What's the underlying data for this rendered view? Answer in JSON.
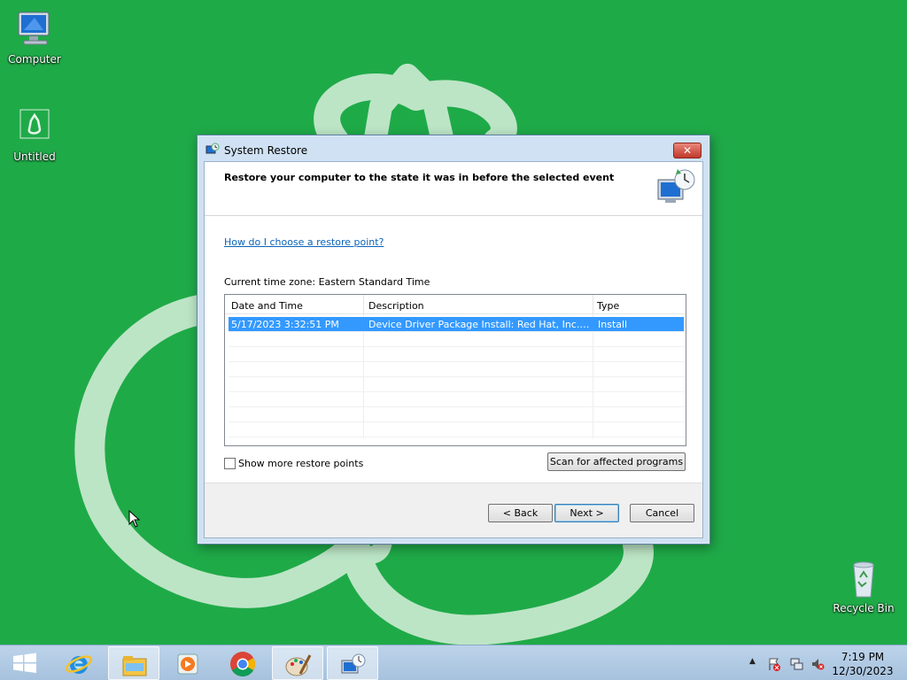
{
  "desktop": {
    "icons": [
      {
        "label": "Computer"
      },
      {
        "label": "Untitled"
      },
      {
        "label": "Recycle Bin"
      }
    ]
  },
  "window": {
    "title": "System Restore",
    "close_label": "✕",
    "heading": "Restore your computer to the state it was in before the selected event",
    "help_link": "How do I choose a restore point?",
    "timezone": "Current time zone: Eastern Standard Time",
    "list": {
      "columns": [
        "Date and Time",
        "Description",
        "Type"
      ],
      "rows": [
        {
          "date": "5/17/2023 3:32:51 PM",
          "description": "Device Driver Package Install: Red Hat, Inc. Net...",
          "type": "Install",
          "selected": true
        }
      ]
    },
    "show_more_label": "Show more restore points",
    "show_more_checked": false,
    "scan_label": "Scan for affected programs",
    "back_label": "< Back",
    "next_label": "Next >",
    "cancel_label": "Cancel"
  },
  "taskbar": {
    "apps": [
      "internet-explorer",
      "file-explorer",
      "media-player",
      "chrome",
      "paint",
      "system-restore"
    ],
    "clock_time": "7:19 PM",
    "clock_date": "12/30/2023",
    "tray_arrow": "▲"
  },
  "colors": {
    "desktop": "#1faa48",
    "selection": "#3399ff",
    "link": "#0a63b9"
  }
}
